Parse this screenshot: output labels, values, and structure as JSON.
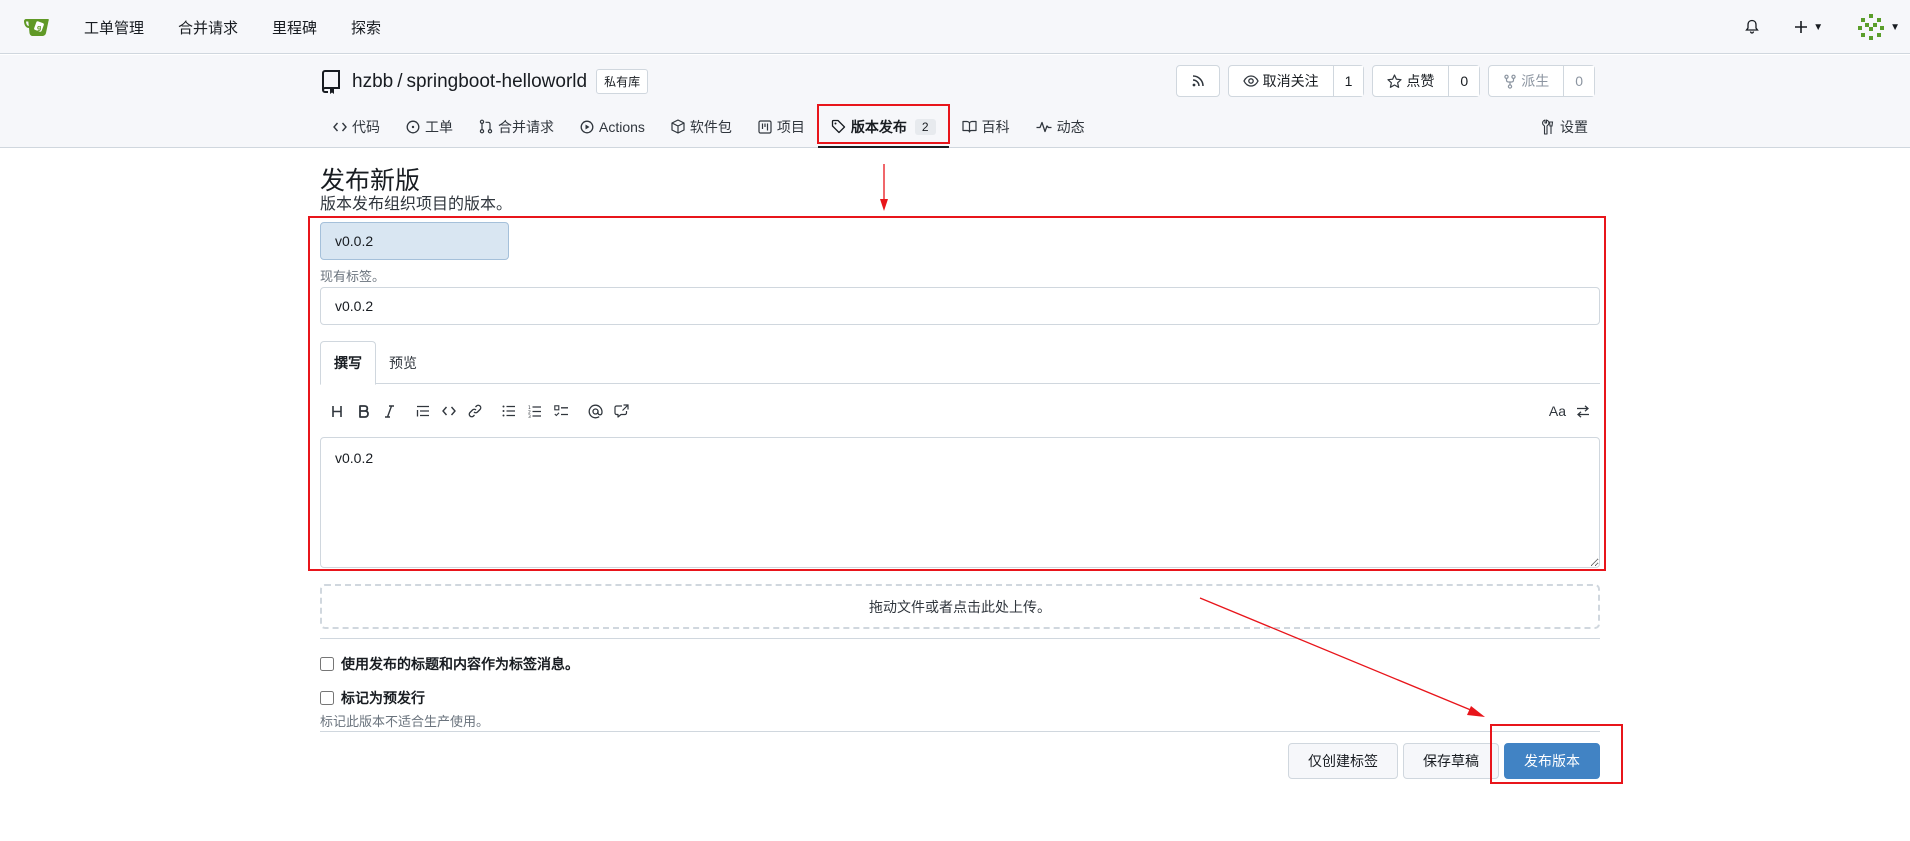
{
  "topnav": {
    "items": [
      "工单管理",
      "合并请求",
      "里程碑",
      "探索"
    ]
  },
  "repo": {
    "owner": "hzbb",
    "separator": "/",
    "name": "springboot-helloworld",
    "private_label": "私有库",
    "watch_label": "取消关注",
    "watch_count": "1",
    "star_label": "点赞",
    "star_count": "0",
    "fork_label": "派生",
    "fork_count": "0"
  },
  "tabs": {
    "code": "代码",
    "issues": "工单",
    "pulls": "合并请求",
    "actions": "Actions",
    "packages": "软件包",
    "projects": "项目",
    "releases": "版本发布",
    "releases_count": "2",
    "wiki": "百科",
    "activity": "动态",
    "settings": "设置"
  },
  "form": {
    "page_title": "发布新版",
    "page_desc": "版本发布组织项目的版本。",
    "tag_value": "v0.0.2",
    "existing_tag_hint": "现有标签。",
    "title_value": "v0.0.2",
    "write_tab": "撰写",
    "preview_tab": "预览",
    "body_value": "v0.0.2",
    "font_toggle": "Aa",
    "dropzone_text": "拖动文件或者点击此处上传。",
    "tag_message_label": "使用发布的标题和内容作为标签消息。",
    "prerelease_label": "标记为预发行",
    "prerelease_hint": "标记此版本不适合生产使用。",
    "tag_only_button": "仅创建标签",
    "draft_button": "保存草稿",
    "publish_button": "发布版本"
  },
  "colors": {
    "accent": "#4183c4",
    "annotation": "#e8151b",
    "logo": "#609926"
  }
}
